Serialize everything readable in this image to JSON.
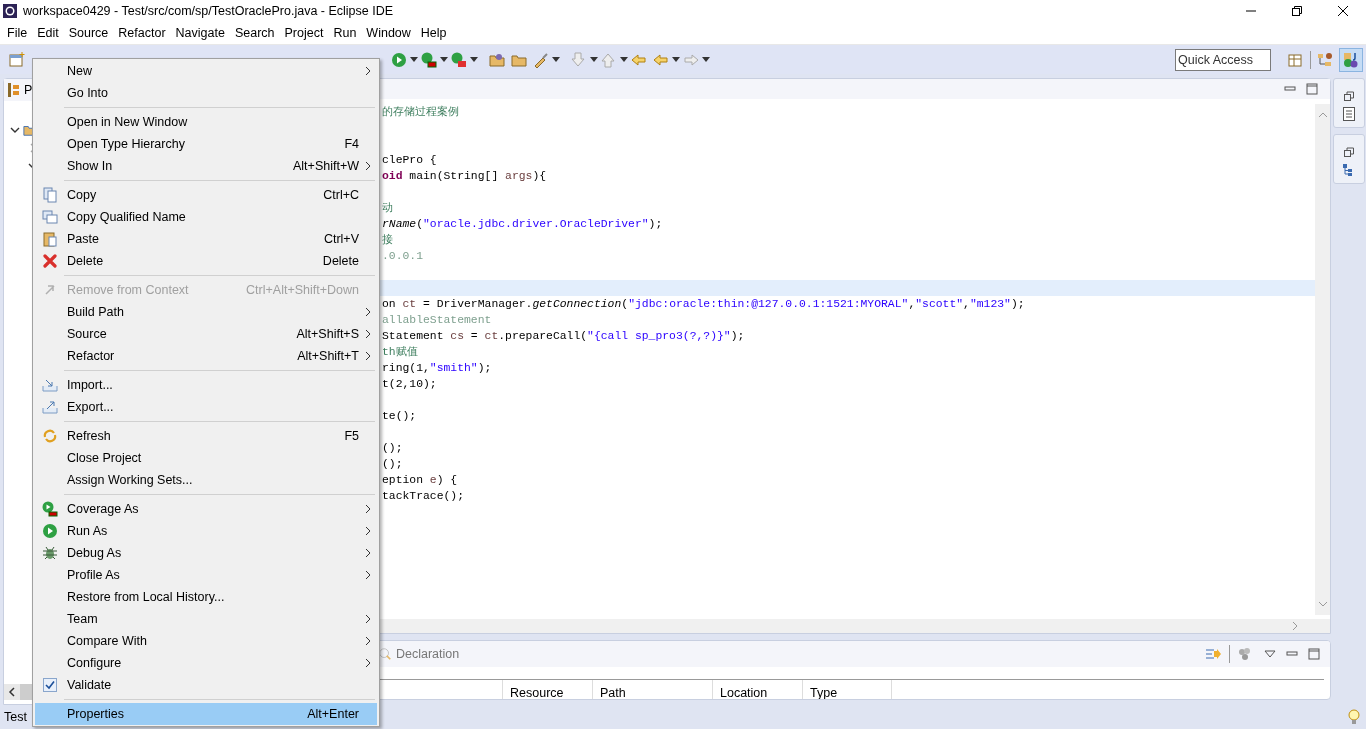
{
  "window": {
    "title": "workspace0429 - Test/src/com/sp/TestOraclePro.java - Eclipse IDE"
  },
  "menubar": [
    "File",
    "Edit",
    "Source",
    "Refactor",
    "Navigate",
    "Search",
    "Project",
    "Run",
    "Window",
    "Help"
  ],
  "toolbar": {
    "quick_access": {
      "placeholder": "Quick Access"
    }
  },
  "explorer": {
    "tab_label": "P",
    "tree": [
      {
        "expanded": true,
        "children": [
          {
            "expanded": false
          },
          {
            "expanded": true
          }
        ]
      }
    ]
  },
  "editor": {
    "lines": [
      {
        "current": false,
        "segments": [
          {
            "kind": "comment",
            "text": "的存储过程案例"
          }
        ]
      },
      {
        "current": false
      },
      {
        "current": false
      },
      {
        "current": false,
        "segments": [
          {
            "kind": "plain",
            "text": "clePro {"
          }
        ]
      },
      {
        "current": false,
        "segments": [
          {
            "kind": "keyword",
            "text": "oid"
          },
          {
            "kind": "plain",
            "text": " main(String[] "
          },
          {
            "kind": "var",
            "text": "args"
          },
          {
            "kind": "plain",
            "text": "){"
          }
        ]
      },
      {
        "current": false
      },
      {
        "current": false,
        "segments": [
          {
            "kind": "comment",
            "text": "动"
          }
        ]
      },
      {
        "current": false,
        "segments": [
          {
            "kind": "italic",
            "text": "rName"
          },
          {
            "kind": "plain",
            "text": "("
          },
          {
            "kind": "string",
            "text": "\"oracle.jdbc.driver.OracleDriver\""
          },
          {
            "kind": "plain",
            "text": ");"
          }
        ]
      },
      {
        "current": false,
        "segments": [
          {
            "kind": "comment",
            "text": "接"
          }
        ]
      },
      {
        "current": false,
        "segments": [
          {
            "kind": "faded",
            "text": ".0.0.1"
          }
        ]
      },
      {
        "current": false
      },
      {
        "current": true
      },
      {
        "current": false,
        "segments": [
          {
            "kind": "plain",
            "text": "on "
          },
          {
            "kind": "var",
            "text": "ct"
          },
          {
            "kind": "plain",
            "text": " = DriverManager."
          },
          {
            "kind": "italic",
            "text": "getConnection"
          },
          {
            "kind": "plain",
            "text": "("
          },
          {
            "kind": "string",
            "text": "\"jdbc:oracle:thin:@127.0.0.1:1521:MYORAL\""
          },
          {
            "kind": "plain",
            "text": ","
          },
          {
            "kind": "string",
            "text": "\"scott\""
          },
          {
            "kind": "plain",
            "text": ","
          },
          {
            "kind": "string",
            "text": "\"m123\""
          },
          {
            "kind": "plain",
            "text": ");"
          }
        ]
      },
      {
        "current": false,
        "segments": [
          {
            "kind": "faded",
            "text": "allableStatement"
          }
        ]
      },
      {
        "current": false,
        "segments": [
          {
            "kind": "plain",
            "text": "Statement "
          },
          {
            "kind": "var",
            "text": "cs"
          },
          {
            "kind": "plain",
            "text": " = "
          },
          {
            "kind": "var",
            "text": "ct"
          },
          {
            "kind": "plain",
            "text": ".prepareCall("
          },
          {
            "kind": "string",
            "text": "\"{call sp_pro3(?,?)}\""
          },
          {
            "kind": "plain",
            "text": ");"
          }
        ]
      },
      {
        "current": false,
        "segments": [
          {
            "kind": "comment",
            "text": "th赋值"
          }
        ]
      },
      {
        "current": false,
        "segments": [
          {
            "kind": "plain",
            "text": "ring(1,"
          },
          {
            "kind": "string",
            "text": "\"smith\""
          },
          {
            "kind": "plain",
            "text": ");"
          }
        ]
      },
      {
        "current": false,
        "segments": [
          {
            "kind": "plain",
            "text": "t(2,10);"
          }
        ]
      },
      {
        "current": false
      },
      {
        "current": false,
        "segments": [
          {
            "kind": "plain",
            "text": "te();"
          }
        ]
      },
      {
        "current": false
      },
      {
        "current": false,
        "segments": [
          {
            "kind": "plain",
            "text": "();"
          }
        ]
      },
      {
        "current": false,
        "segments": [
          {
            "kind": "plain",
            "text": "();"
          }
        ]
      },
      {
        "current": false,
        "segments": [
          {
            "kind": "plain",
            "text": "eption "
          },
          {
            "kind": "var",
            "text": "e"
          },
          {
            "kind": "plain",
            "text": ") {"
          }
        ]
      },
      {
        "current": false,
        "segments": [
          {
            "kind": "plain",
            "text": "tackTrace();"
          }
        ]
      }
    ]
  },
  "bottom_panel": {
    "tab_label": "Declaration",
    "columns": [
      "Resource",
      "Path",
      "Location",
      "Type"
    ]
  },
  "context_menu": [
    [
      {
        "label": "New",
        "submenu": true,
        "disabled": false,
        "selected": false
      },
      {
        "label": "Go Into",
        "submenu": false,
        "disabled": false,
        "selected": false
      }
    ],
    [
      {
        "label": "Open in New Window",
        "submenu": false,
        "disabled": false,
        "selected": false
      },
      {
        "label": "Open Type Hierarchy",
        "shortcut": "F4",
        "submenu": false,
        "disabled": false,
        "selected": false
      },
      {
        "label": "Show In",
        "shortcut": "Alt+Shift+W",
        "submenu": true,
        "disabled": false,
        "selected": false
      }
    ],
    [
      {
        "label": "Copy",
        "shortcut": "Ctrl+C",
        "submenu": false,
        "disabled": false,
        "selected": false
      },
      {
        "label": "Copy Qualified Name",
        "submenu": false,
        "disabled": false,
        "selected": false
      },
      {
        "label": "Paste",
        "shortcut": "Ctrl+V",
        "submenu": false,
        "disabled": false,
        "selected": false
      },
      {
        "label": "Delete",
        "shortcut": "Delete",
        "submenu": false,
        "disabled": false,
        "selected": false
      }
    ],
    [
      {
        "label": "Remove from Context",
        "shortcut": "Ctrl+Alt+Shift+Down",
        "submenu": false,
        "disabled": true,
        "selected": false
      },
      {
        "label": "Build Path",
        "submenu": true,
        "disabled": false,
        "selected": false
      },
      {
        "label": "Source",
        "shortcut": "Alt+Shift+S",
        "submenu": true,
        "disabled": false,
        "selected": false
      },
      {
        "label": "Refactor",
        "shortcut": "Alt+Shift+T",
        "submenu": true,
        "disabled": false,
        "selected": false
      }
    ],
    [
      {
        "label": "Import...",
        "submenu": false,
        "disabled": false,
        "selected": false
      },
      {
        "label": "Export...",
        "submenu": false,
        "disabled": false,
        "selected": false
      }
    ],
    [
      {
        "label": "Refresh",
        "shortcut": "F5",
        "submenu": false,
        "disabled": false,
        "selected": false
      },
      {
        "label": "Close Project",
        "submenu": false,
        "disabled": false,
        "selected": false
      },
      {
        "label": "Assign Working Sets...",
        "submenu": false,
        "disabled": false,
        "selected": false
      }
    ],
    [
      {
        "label": "Coverage As",
        "submenu": true,
        "disabled": false,
        "selected": false
      },
      {
        "label": "Run As",
        "submenu": true,
        "disabled": false,
        "selected": false
      },
      {
        "label": "Debug As",
        "submenu": true,
        "disabled": false,
        "selected": false
      },
      {
        "label": "Profile As",
        "submenu": true,
        "disabled": false,
        "selected": false
      },
      {
        "label": "Restore from Local History...",
        "submenu": false,
        "disabled": false,
        "selected": false
      },
      {
        "label": "Team",
        "submenu": true,
        "disabled": false,
        "selected": false
      },
      {
        "label": "Compare With",
        "submenu": true,
        "disabled": false,
        "selected": false
      },
      {
        "label": "Configure",
        "submenu": true,
        "disabled": false,
        "selected": false
      },
      {
        "label": "Validate",
        "submenu": false,
        "disabled": false,
        "selected": false,
        "kind": "checkbox",
        "checked": true
      }
    ],
    [
      {
        "label": "Properties",
        "shortcut": "Alt+Enter",
        "submenu": false,
        "disabled": false,
        "selected": true
      }
    ]
  ],
  "status_bar": {
    "text": "Test"
  }
}
